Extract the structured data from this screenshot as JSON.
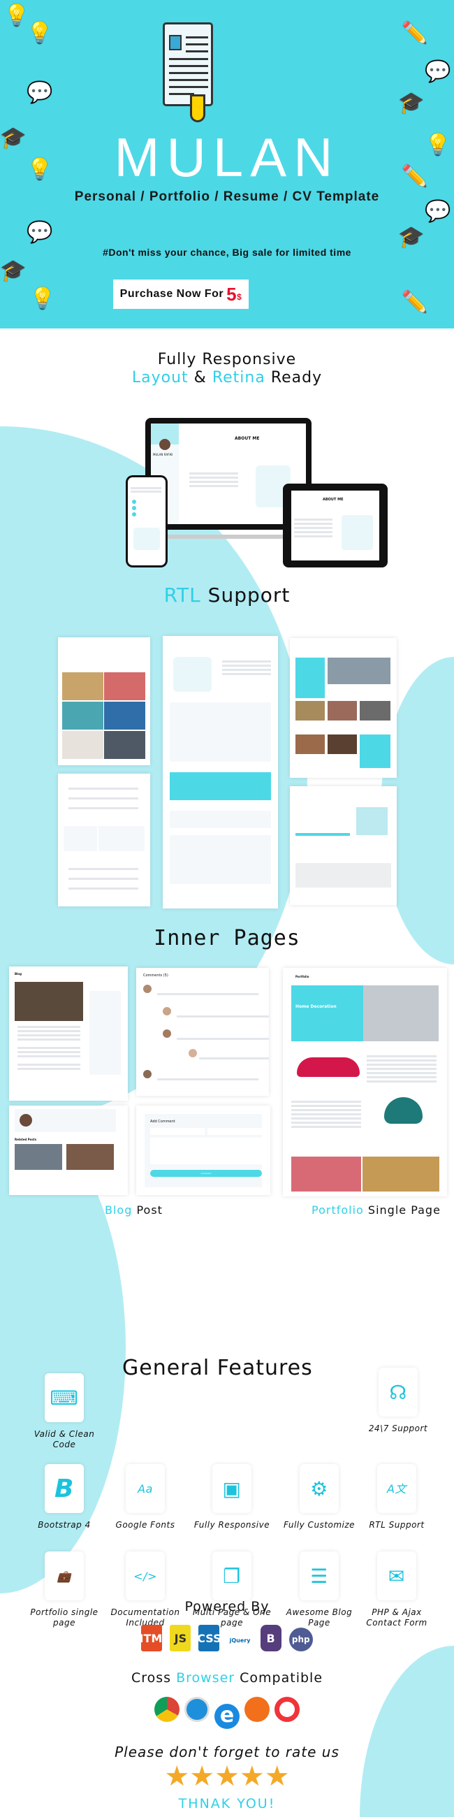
{
  "hero": {
    "title": "MULAN",
    "subtitle": "Personal / Portfolio / Resume / CV  Template",
    "sale": "#Don't miss your chance, Big sale for limited time",
    "purchase": {
      "label": "Purchase Now For",
      "price": "5",
      "currency": "$"
    },
    "bg": "#4dd8e6"
  },
  "responsive": {
    "line1": "Fully Responsive",
    "w1": "Layout",
    "amp": "&",
    "w2": "Retina",
    "w3": "Ready",
    "screen": {
      "heading": "ABOUT ME",
      "name": "MULAN RAFIKI",
      "tablet_heading": "ABOUT ME"
    }
  },
  "rtl": {
    "w1": "RTL",
    "w2": "Support"
  },
  "inner": {
    "title": "Inner Pages",
    "blog_label": "Blog",
    "blog_label2": "Post",
    "portfolio_label": "Portfolio",
    "portfolio_label2": "Single Page",
    "comments_title": "Comments (5)",
    "add_comment": "Add Comment",
    "comment_button": "Comment",
    "portfolio_heading": "Portfolio",
    "portfolio_hero": "Home Decoration",
    "blog_heading": "Blog",
    "related": "Related Posts"
  },
  "features": {
    "title": "General Features",
    "items": [
      "Valid & Clean Code",
      "24\\7 Support",
      "Bootstrap 4",
      "Google Fonts",
      "Fully Responsive",
      "Fully Customize",
      "RTL Support",
      "Portfolio single page",
      "Documentation Included",
      "Multi Page & One page",
      "Awesome Blog Page",
      "PHP & Ajax Contact Form"
    ],
    "icons": [
      "laptop-code-icon",
      "support-headset-icon",
      "bootstrap-icon",
      "font-file-icon",
      "devices-icon",
      "monitor-gear-icon",
      "translate-icon",
      "briefcase-monitor-icon",
      "book-code-icon",
      "pages-icon",
      "newspaper-icon",
      "envelope-icon"
    ]
  },
  "powered": {
    "title": "Powered By",
    "logos": [
      "HTML",
      "JS",
      "CSS",
      "jQuery",
      "B",
      "php"
    ]
  },
  "browsers": {
    "w1": "Cross",
    "w2": "Browser",
    "w3": "Compatible",
    "list": [
      "chrome",
      "safari",
      "ie",
      "firefox",
      "opera"
    ]
  },
  "rate": {
    "text": "Please don't forget to rate us",
    "stars": 5,
    "thanks": "THNAK YOU!"
  },
  "colors": {
    "accent": "#2fd0e6",
    "circle": "#b2ecf3",
    "price": "#e8112d",
    "star": "#f3a927"
  }
}
